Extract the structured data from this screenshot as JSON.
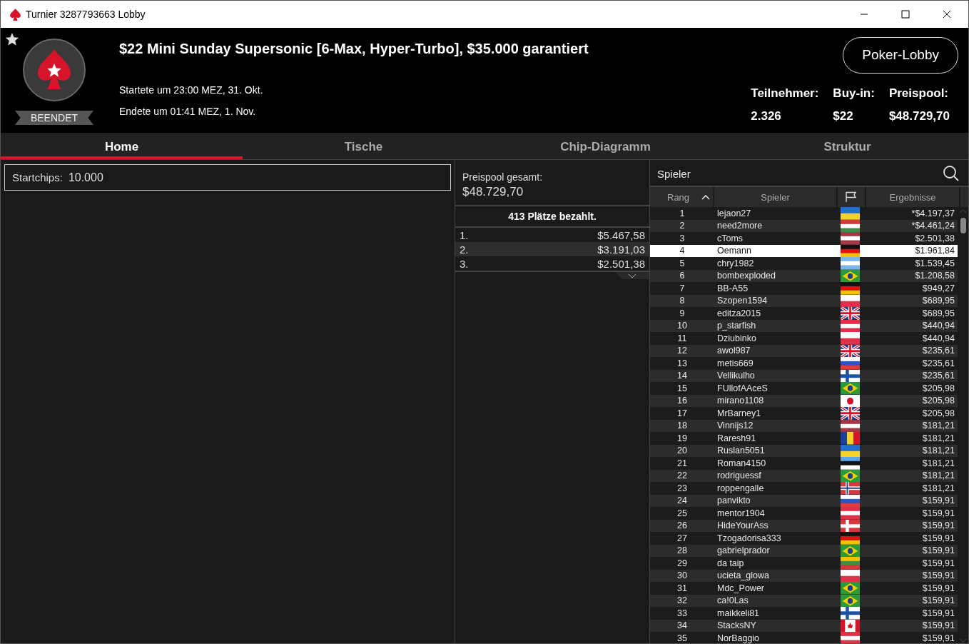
{
  "window": {
    "title": "Turnier 3287793663 Lobby"
  },
  "header": {
    "favorite": true,
    "status": "BEENDET",
    "title": "$22 Mini Sunday Supersonic [6-Max, Hyper-Turbo], $35.000 garantiert",
    "started": "Startete um 23:00 MEZ, 31. Okt.",
    "ended": "Endete um 01:41 MEZ, 1. Nov.",
    "lobby_button": "Poker-Lobby",
    "stats": [
      {
        "label": "Teilnehmer:",
        "value": "2.326"
      },
      {
        "label": "Buy-in:",
        "value": "$22"
      },
      {
        "label": "Preispool:",
        "value": "$48.729,70"
      }
    ]
  },
  "tabs": [
    {
      "label": "Home",
      "selected": true
    },
    {
      "label": "Tische",
      "selected": false
    },
    {
      "label": "Chip-Diagramm",
      "selected": false
    },
    {
      "label": "Struktur",
      "selected": false
    }
  ],
  "startchips": {
    "label": "Startchips:",
    "value": "10.000"
  },
  "prizes": {
    "label": "Preispool gesamt:",
    "total": "$48.729,70",
    "paid": "413 Plätze bezahlt.",
    "rows": [
      {
        "place": "1.",
        "amount": "$5.467,58"
      },
      {
        "place": "2.",
        "amount": "$3.191,03"
      },
      {
        "place": "3.",
        "amount": "$2.501,38"
      }
    ]
  },
  "players": {
    "title": "Spieler",
    "columns": [
      "Rang",
      "Spieler",
      "Ergebnisse"
    ],
    "rows": [
      {
        "rank": "1",
        "name": "lejaon27",
        "kind": "ua",
        "result": "*$4.197,37",
        "selected": false
      },
      {
        "rank": "2",
        "name": "need2more",
        "kind": "hu",
        "result": "*$4.461,24",
        "selected": false
      },
      {
        "rank": "3",
        "name": "cToms",
        "kind": "lv",
        "result": "$2.501,38",
        "selected": false
      },
      {
        "rank": "4",
        "name": "Oemann",
        "kind": "de",
        "result": "$1.961,84",
        "selected": true
      },
      {
        "rank": "5",
        "name": "chry1982",
        "kind": "ar",
        "result": "$1.539,45",
        "selected": false
      },
      {
        "rank": "6",
        "name": "bombexploded",
        "kind": "br",
        "result": "$1.208,58",
        "selected": false
      },
      {
        "rank": "7",
        "name": "BB-A55",
        "kind": "de",
        "result": "$949,27",
        "selected": false
      },
      {
        "rank": "8",
        "name": "Szopen1594",
        "kind": "pl",
        "result": "$689,95",
        "selected": false
      },
      {
        "rank": "9",
        "name": "editza2015",
        "kind": "gb",
        "result": "$689,95",
        "selected": false
      },
      {
        "rank": "10",
        "name": "p_starfish",
        "kind": "at",
        "result": "$440,94",
        "selected": false
      },
      {
        "rank": "11",
        "name": "Dziubinko",
        "kind": "pl",
        "result": "$440,94",
        "selected": false
      },
      {
        "rank": "12",
        "name": "awol987",
        "kind": "gb",
        "result": "$235,61",
        "selected": false
      },
      {
        "rank": "13",
        "name": "metis669",
        "kind": "ru",
        "result": "$235,61",
        "selected": false
      },
      {
        "rank": "14",
        "name": "Vellikulho",
        "kind": "fi",
        "result": "$235,61",
        "selected": false
      },
      {
        "rank": "15",
        "name": "FUllofAAceS",
        "kind": "br",
        "result": "$205,98",
        "selected": false
      },
      {
        "rank": "16",
        "name": "mirano1108",
        "kind": "jp",
        "result": "$205,98",
        "selected": false
      },
      {
        "rank": "17",
        "name": "MrBarney1",
        "kind": "gb",
        "result": "$205,98",
        "selected": false
      },
      {
        "rank": "18",
        "name": "Vinnijs12",
        "kind": "lv",
        "result": "$181,21",
        "selected": false
      },
      {
        "rank": "19",
        "name": "Raresh91",
        "kind": "ro",
        "result": "$181,21",
        "selected": false
      },
      {
        "rank": "20",
        "name": "Ruslan5051",
        "kind": "ua",
        "result": "$181,21",
        "selected": false
      },
      {
        "rank": "21",
        "name": "Roman4150",
        "kind": "ee",
        "result": "$181,21",
        "selected": false
      },
      {
        "rank": "22",
        "name": "rodriguessf",
        "kind": "br",
        "result": "$181,21",
        "selected": false
      },
      {
        "rank": "23",
        "name": "roppengalle",
        "kind": "no",
        "result": "$181,21",
        "selected": false
      },
      {
        "rank": "24",
        "name": "panvikto",
        "kind": "ru",
        "result": "$159,91",
        "selected": false
      },
      {
        "rank": "25",
        "name": "mentor1904",
        "kind": "at",
        "result": "$159,91",
        "selected": false
      },
      {
        "rank": "26",
        "name": "HideYourAss",
        "kind": "dk",
        "result": "$159,91",
        "selected": false
      },
      {
        "rank": "27",
        "name": "Tzogadorisa333",
        "kind": "de",
        "result": "$159,91",
        "selected": false
      },
      {
        "rank": "28",
        "name": "gabrielprador",
        "kind": "br",
        "result": "$159,91",
        "selected": false
      },
      {
        "rank": "29",
        "name": "da taip",
        "kind": "lt",
        "result": "$159,91",
        "selected": false
      },
      {
        "rank": "30",
        "name": "ucieta_glowa",
        "kind": "pl",
        "result": "$159,91",
        "selected": false
      },
      {
        "rank": "31",
        "name": "Mdc_Power",
        "kind": "br",
        "result": "$159,91",
        "selected": false
      },
      {
        "rank": "32",
        "name": "ca!0Las",
        "kind": "br",
        "result": "$159,91",
        "selected": false
      },
      {
        "rank": "33",
        "name": "maikkeli81",
        "kind": "fi",
        "result": "$159,91",
        "selected": false
      },
      {
        "rank": "34",
        "name": "StacksNY",
        "kind": "ca",
        "result": "$159,91",
        "selected": false
      },
      {
        "rank": "35",
        "name": "NorBaggio",
        "kind": "at",
        "result": "$159,91",
        "selected": false
      }
    ]
  }
}
